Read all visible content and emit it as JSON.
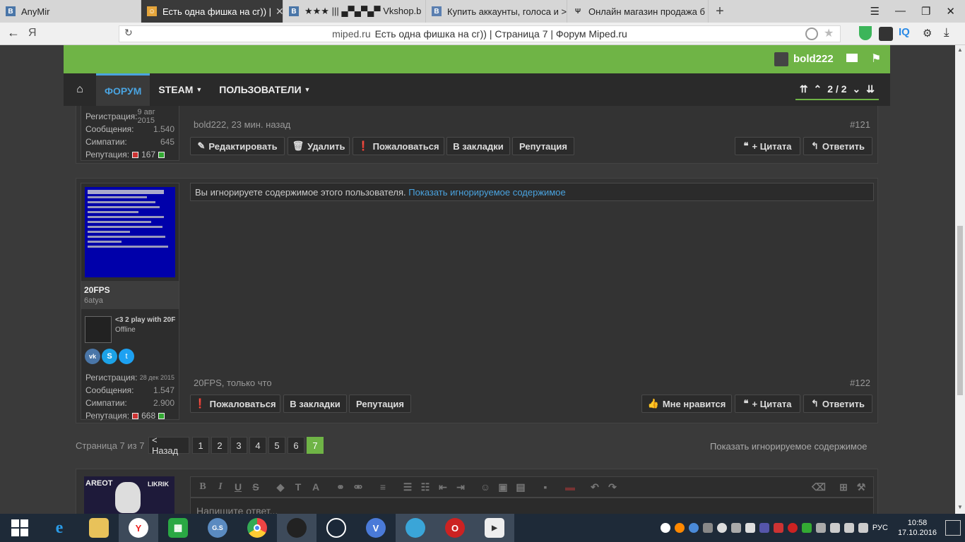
{
  "browser": {
    "tabs": [
      {
        "label": "AnyMir",
        "fav": "vk-icon",
        "active": false
      },
      {
        "label": "Есть одна фишка на сг)) |",
        "fav": "forum-icon",
        "active": true
      },
      {
        "label": "★★★ ||| ▄▀▄▀▄▀ Vkshop.b",
        "fav": "vk-icon",
        "active": false
      },
      {
        "label": "Купить аккаунты, голоса и >",
        "fav": "b-icon",
        "active": false
      },
      {
        "label": "Онлайн магазин продажа б",
        "fav": "store-icon",
        "active": false
      }
    ],
    "new_tab": "+",
    "address_host": "miped.ru",
    "address_title": "Есть одна фишка на сг)) | Страница 7 | Форум Miped.ru",
    "back": "←",
    "yandex_logo": "Я",
    "iq_label": "IQ"
  },
  "site": {
    "username": "bold222",
    "nav": {
      "forum": "ФОРУМ",
      "steam": "STEAM",
      "users": "ПОЛЬЗОВАТЕЛИ",
      "page_indicator": "2 / 2"
    }
  },
  "post121": {
    "stats": [
      {
        "label": "Регистрация:",
        "value": "9 авг 2015"
      },
      {
        "label": "Сообщения:",
        "value": "1.540"
      },
      {
        "label": "Симпатии:",
        "value": "645"
      }
    ],
    "rep_label": "Репутация:",
    "rep_value": "167",
    "meta": "bold222, 23 мин. назад",
    "number": "#121",
    "buttons": {
      "edit": "Редактировать",
      "delete": "Удалить",
      "report": "Пожаловаться",
      "bookmark": "В закладки",
      "rep": "Репутация",
      "quote": "+ Цитата",
      "reply": "Ответить"
    }
  },
  "post122": {
    "username": "20FPS",
    "usertitle": "6atya",
    "status_title": "<3 2 play with 20F",
    "status": "Offline",
    "stats": [
      {
        "label": "Регистрация:",
        "value": "28 дек 2015"
      },
      {
        "label": "Сообщения:",
        "value": "1.547"
      },
      {
        "label": "Симпатии:",
        "value": "2.900"
      }
    ],
    "rep_label": "Репутация:",
    "rep_value": "668",
    "ignored_text": "Вы игнорируете содержимое этого пользователя.",
    "ignored_link": "Показать игнорируемое содержимое",
    "meta": "20FPS, только что",
    "number": "#122",
    "buttons": {
      "report": "Пожаловаться",
      "bookmark": "В закладки",
      "rep": "Репутация",
      "like": "Мне нравится",
      "quote": "+ Цитата",
      "reply": "Ответить"
    }
  },
  "pagination": {
    "label": "Страница 7 из 7",
    "back": "< Назад",
    "pages": [
      "1",
      "2",
      "3",
      "4",
      "5",
      "6",
      "7"
    ],
    "current": "7",
    "show_ignored": "Показать игнорируемое содержимое"
  },
  "reply": {
    "placeholder": "Напишите ответ...",
    "avatar_text_left": "AREOT",
    "avatar_text_right": "LIKRIK"
  },
  "taskbar": {
    "lang": "РУС",
    "time": "10:58",
    "date": "17.10.2016"
  },
  "colors": {
    "green": "#6fb446",
    "link": "#4aa3df",
    "bg": "#3a3a3a"
  }
}
